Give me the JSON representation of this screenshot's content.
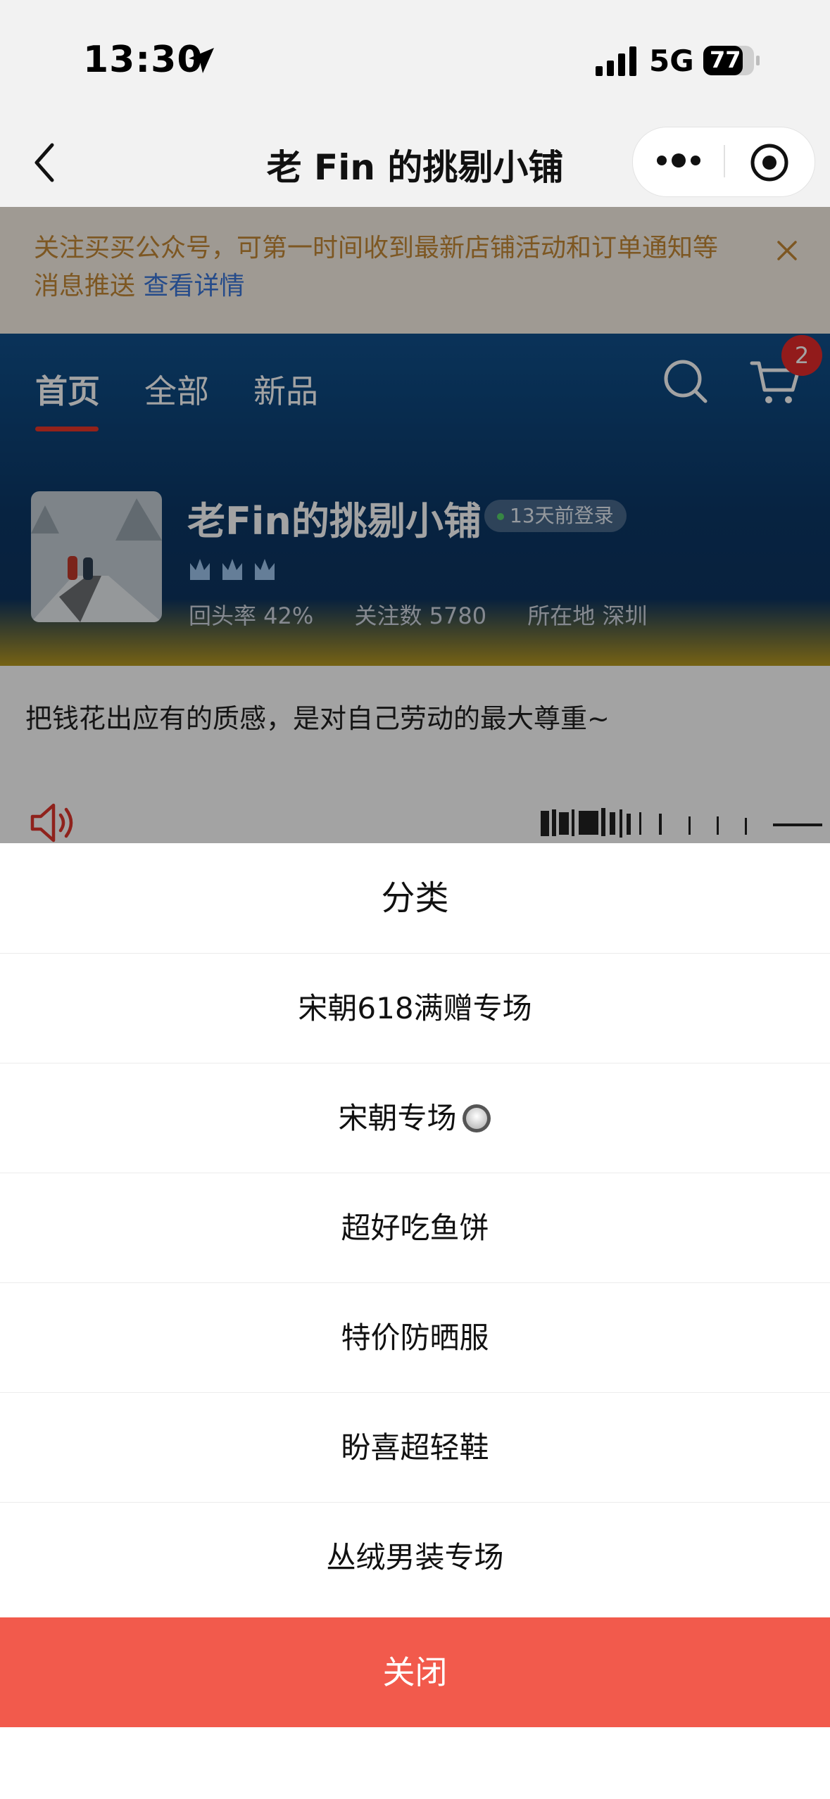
{
  "status_bar": {
    "time": "13:30",
    "network": "5G",
    "battery": "77"
  },
  "nav": {
    "title": "老 Fin 的挑剔小铺"
  },
  "notice": {
    "text": "关注买买公众号，可第一时间收到最新店铺活动和订单通知等消息推送",
    "link": "查看详情"
  },
  "shop": {
    "tabs": [
      "首页",
      "全部",
      "新品"
    ],
    "cart_count": "2",
    "name": "老Fin的挑剔小铺",
    "last_login": "13天前登录",
    "stats": {
      "return_rate": "回头率 42%",
      "followers": "关注数 5780",
      "location": "所在地 深圳"
    },
    "slogan": "把钱花出应有的质感，是对自己劳动的最大尊重~"
  },
  "sheet": {
    "title": "分类",
    "categories": [
      "宋朝618满赠专场",
      "宋朝专场",
      "超好吃鱼饼",
      "特价防晒服",
      "盼喜超轻鞋",
      "丛绒男装专场"
    ],
    "close_label": "关闭"
  },
  "colors": {
    "accent_red": "#f25a4c",
    "tab_underline": "#e8362a",
    "notice_text": "#c48836",
    "link_blue": "#3b76d8"
  },
  "icons": [
    "location-arrow-icon",
    "signal-icon",
    "battery-icon",
    "back-chevron-icon",
    "more-dots-icon",
    "mini-close-icon",
    "close-x-icon",
    "search-icon",
    "cart-icon",
    "crown-icon",
    "speaker-icon",
    "radio-icon"
  ]
}
